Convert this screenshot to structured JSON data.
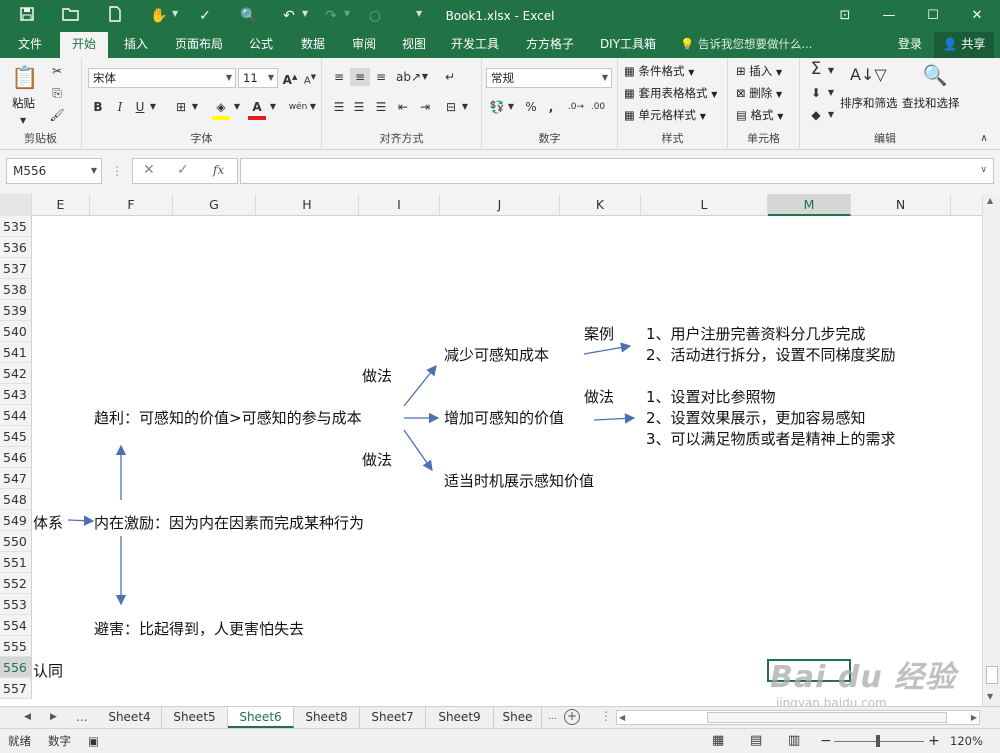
{
  "title": "Book1.xlsx - Excel",
  "tabs": [
    "文件",
    "开始",
    "插入",
    "页面布局",
    "公式",
    "数据",
    "审阅",
    "视图",
    "开发工具",
    "方方格子",
    "DIY工具箱"
  ],
  "tell_me": "告诉我您想要做什么...",
  "login": "登录",
  "share": "共享",
  "ribbon": {
    "paste": "粘贴",
    "clipboard": "剪贴板",
    "font_name": "宋体",
    "font_size": "11",
    "font_group": "字体",
    "align_group": "对齐方式",
    "number_format": "常规",
    "number_group": "数字",
    "cond_format": "条件格式",
    "table_format": "套用表格格式",
    "cell_style": "单元格样式",
    "style_group": "样式",
    "insert": "插入",
    "delete": "删除",
    "format": "格式",
    "cells_group": "单元格",
    "sort_filter": "排序和筛选",
    "find_select": "查找和选择",
    "edit_group": "编辑"
  },
  "namebox": "M556",
  "columns": [
    "E",
    "F",
    "G",
    "H",
    "I",
    "J",
    "K",
    "L",
    "M",
    "N"
  ],
  "rows": [
    "535",
    "536",
    "537",
    "538",
    "539",
    "540",
    "541",
    "542",
    "543",
    "544",
    "545",
    "546",
    "547",
    "548",
    "549",
    "550",
    "551",
    "552",
    "553",
    "554",
    "555",
    "556",
    "557"
  ],
  "cells": {
    "case": "案例",
    "case1": "1、用户注册完善资料分几步完成",
    "case2": "2、活动进行拆分，设置不同梯度奖励",
    "method1": "做法",
    "reduce": "减少可感知成本",
    "method2": "做法",
    "m1": "1、设置对比参照物",
    "m2": "2、设置效果展示，更加容易感知",
    "m3": "3、可以满足物质或者是精神上的需求",
    "benefit": "趋利：可感知的价值>可感知的参与成本",
    "increase": "增加可感知的价值",
    "method3": "做法",
    "timing": "适当时机展示感知价值",
    "system": "体系",
    "intrinsic": "内在激励：因为内在因素而完成某种行为",
    "avoid": "避害：比起得到，人更害怕失去",
    "identity": "认同"
  },
  "sheets": [
    "Sheet4",
    "Sheet5",
    "Sheet6",
    "Sheet8",
    "Sheet7",
    "Sheet9",
    "Shee"
  ],
  "status": {
    "ready": "就绪",
    "num": "数字",
    "zoom": "120%"
  },
  "watermark": {
    "brand": "Bai du 经验",
    "url": "jingyan.baidu.com"
  }
}
